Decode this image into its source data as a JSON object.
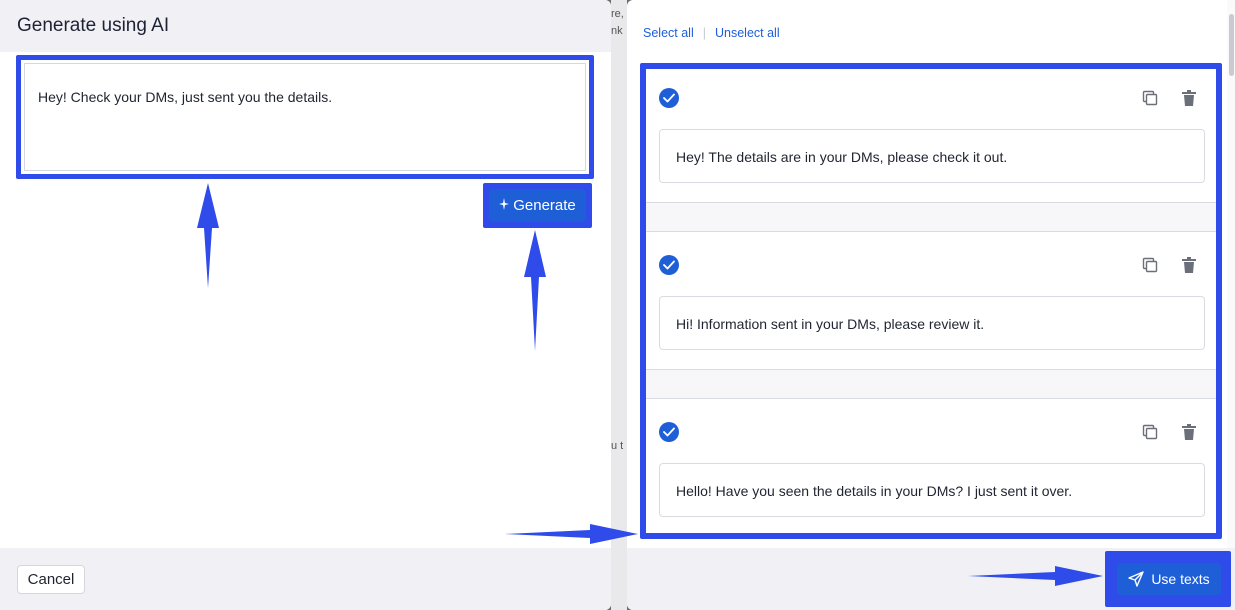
{
  "dialog": {
    "title": "Generate using AI",
    "prompt_text": "Hey! Check your DMs, just sent you the details.",
    "generate_label": "Generate",
    "cancel_label": "Cancel"
  },
  "results": {
    "select_all": "Select all",
    "unselect_all": "Unselect all",
    "separator": "|",
    "items": [
      {
        "text": "Hey! The details are in your DMs, please check it out.",
        "selected": true
      },
      {
        "text": "Hi! Information sent in your DMs, please review it.",
        "selected": true
      },
      {
        "text": "Hello! Have you seen the details in your DMs? I just sent it over.",
        "selected": true
      }
    ],
    "use_texts_label": "Use texts"
  },
  "background": {
    "fragments": [
      "re,",
      "nk",
      "u t"
    ]
  },
  "colors": {
    "accent": "#1e5fd8",
    "highlight": "#2f4bea",
    "panel_bg": "#f1f1f5"
  },
  "icons": {
    "generate": "sparkle-icon",
    "select": "check-circle-icon",
    "copy": "copy-icon",
    "delete": "trash-icon",
    "use_texts": "send-icon"
  }
}
